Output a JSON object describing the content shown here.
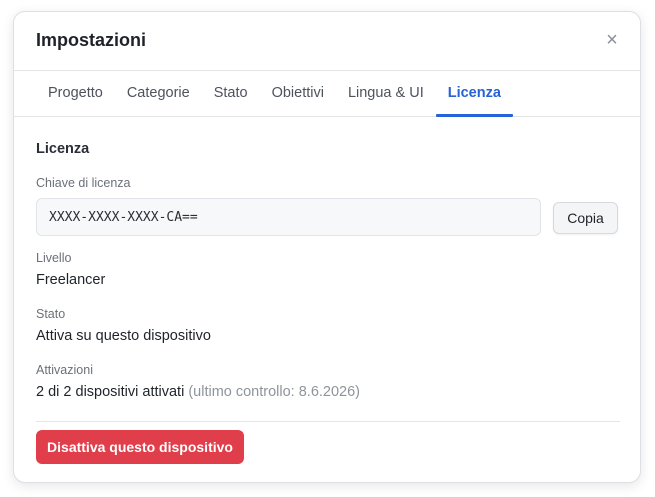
{
  "dialog": {
    "title": "Impostazioni",
    "close_glyph": "×"
  },
  "tabs": [
    {
      "label": "Progetto",
      "active": false
    },
    {
      "label": "Categorie",
      "active": false
    },
    {
      "label": "Stato",
      "active": false
    },
    {
      "label": "Obiettivi",
      "active": false
    },
    {
      "label": "Lingua & UI",
      "active": false
    },
    {
      "label": "Licenza",
      "active": true
    }
  ],
  "license": {
    "section_title": "Licenza",
    "key_label": "Chiave di licenza",
    "key_value": "XXXX-XXXX-XXXX-CA==",
    "copy_label": "Copia",
    "level_label": "Livello",
    "level_value": "Freelancer",
    "status_label": "Stato",
    "status_value": "Attiva su questo dispositivo",
    "activations_label": "Attivazioni",
    "activations_value": "2 di 2 dispositivi attivati",
    "activations_note": "(ultimo controllo: 8.6.2026)",
    "deactivate_label": "Disattiva questo dispositivo"
  },
  "colors": {
    "accent": "#2563d6",
    "danger": "#e03e4a"
  },
  "icons": {
    "close": "close-icon"
  }
}
